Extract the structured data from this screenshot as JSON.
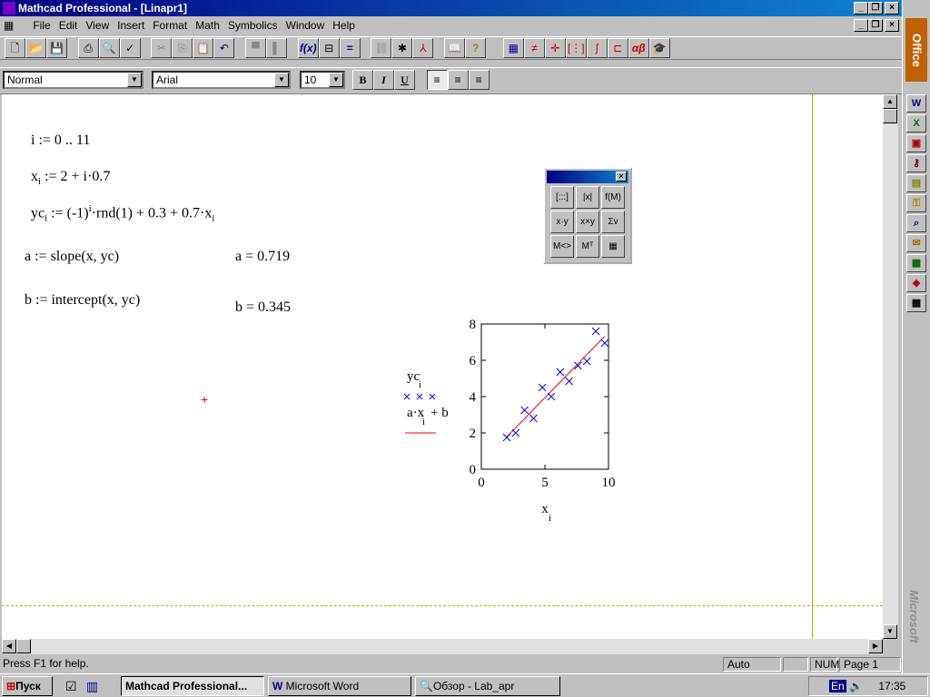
{
  "window": {
    "title": "Mathcad Professional - [Linapr1]"
  },
  "menu": [
    "File",
    "Edit",
    "View",
    "Insert",
    "Format",
    "Math",
    "Symbolics",
    "Window",
    "Help"
  ],
  "format_bar": {
    "style": "Normal",
    "font": "Arial",
    "size": "10",
    "bold": "B",
    "italic": "I",
    "underline": "U"
  },
  "worksheet": {
    "range_def": "i := 0 .. 11",
    "x_def": {
      "lhs": "x",
      "sub": "i",
      "rhs": ":= 2 + i·0.7"
    },
    "yc_def": {
      "lhs": "yc",
      "sub": "i",
      "a": ":= (-1)",
      "sup": "i",
      "b": "·rnd(1) + 0.3 + 0.7·x",
      "sub2": "i"
    },
    "a_def": "a := slope(x, yc)",
    "b_def": "b := intercept(x, yc)",
    "a_val": "a = 0.719",
    "b_val": "b = 0.345"
  },
  "palette": {
    "buttons": [
      "[:::]",
      "|x|",
      "f(M)",
      "x·y",
      "x×y",
      "Σv",
      "M<>",
      "Mᵀ",
      "▦"
    ]
  },
  "chart_data": {
    "type": "scatter",
    "x": [
      2,
      2.7,
      3.4,
      4.1,
      4.8,
      5.5,
      6.2,
      6.9,
      7.6,
      8.3,
      9.0,
      9.7
    ],
    "series": [
      {
        "name": "yc_i",
        "values": [
          1.75,
          2.0,
          3.25,
          2.8,
          4.5,
          4.0,
          5.35,
          4.85,
          5.7,
          5.95,
          7.6,
          6.95
        ],
        "marker": "x",
        "color": "#0000ff"
      },
      {
        "name": "a·x_i + b",
        "type": "line",
        "slope": 0.719,
        "intercept": 0.345,
        "color": "#ff0000"
      }
    ],
    "xlim": [
      0,
      10
    ],
    "ylim": [
      0,
      8
    ],
    "xticks": [
      "0",
      "5",
      "10"
    ],
    "yticks": [
      "0",
      "2",
      "4",
      "6",
      "8"
    ],
    "xlabel": "x",
    "xlabel_sub": "i",
    "legend": {
      "s1": "yc",
      "s1_sub": "i",
      "s2a": "a·x",
      "s2_sub": "i",
      "s2b": " + b",
      "placement": "left"
    }
  },
  "status": {
    "help": "Press F1 for help.",
    "mode": "Auto",
    "num": "NUM",
    "page": "Page 1"
  },
  "taskbar": {
    "start": "Пуск",
    "tasks": [
      "Mathcad Professional...",
      "Microsoft Word",
      "Обзор - Lab_apr"
    ],
    "lang": "En",
    "clock": "17:35"
  },
  "office_bar": {
    "label": "Office",
    "brand": "Microsoft"
  }
}
